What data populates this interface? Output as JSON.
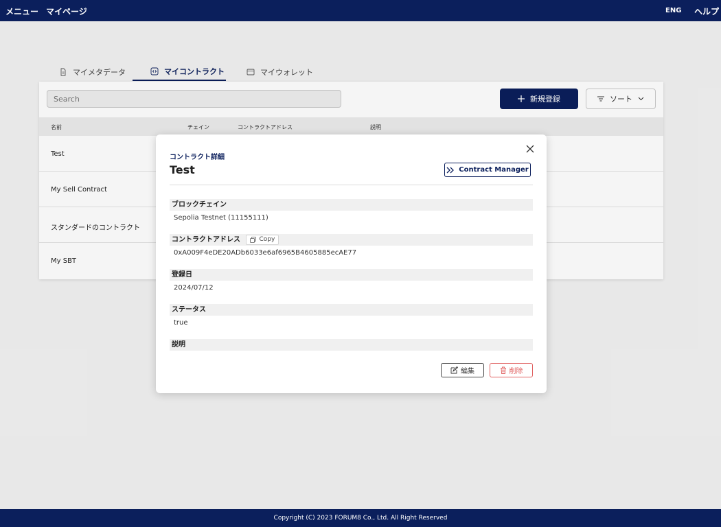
{
  "topbar": {
    "menu": "メニュー",
    "mypage": "マイページ",
    "lang": "ENG",
    "help": "ヘルプ"
  },
  "tabs": [
    {
      "label": "マイメタデータ",
      "icon": "document-icon"
    },
    {
      "label": "マイコントラクト",
      "icon": "code-icon"
    },
    {
      "label": "マイウォレット",
      "icon": "wallet-icon"
    }
  ],
  "toolbar": {
    "search_placeholder": "Search",
    "new_label": "新規登録",
    "sort_label": "ソート"
  },
  "table": {
    "headers": [
      "名前",
      "チェイン",
      "コントラクトアドレス",
      "説明"
    ],
    "rows": [
      "Test",
      "My Sell Contract",
      "スタンダードのコントラクト",
      "My SBT"
    ]
  },
  "modal": {
    "subtitle": "コントラクト詳細",
    "title": "Test",
    "manager_label": "Contract Manager",
    "fields": [
      {
        "label": "ブロックチェイン",
        "value": "Sepolia Testnet (11155111)"
      },
      {
        "label": "コントラクトアドレス",
        "value": "0xA009F4eDE20ADb6033e6af6965B4605885ecAE77",
        "copy_label": "Copy"
      },
      {
        "label": "登録日",
        "value": "2024/07/12"
      },
      {
        "label": "ステータス",
        "value": "true"
      },
      {
        "label": "説明",
        "value": ""
      }
    ],
    "edit_label": "編集",
    "delete_label": "削除"
  },
  "footer": "Copyright (C) 2023 FORUM8 Co., Ltd. All Right Reserved",
  "colors": {
    "navy": "#0b1f5c",
    "danger": "#e06060"
  }
}
